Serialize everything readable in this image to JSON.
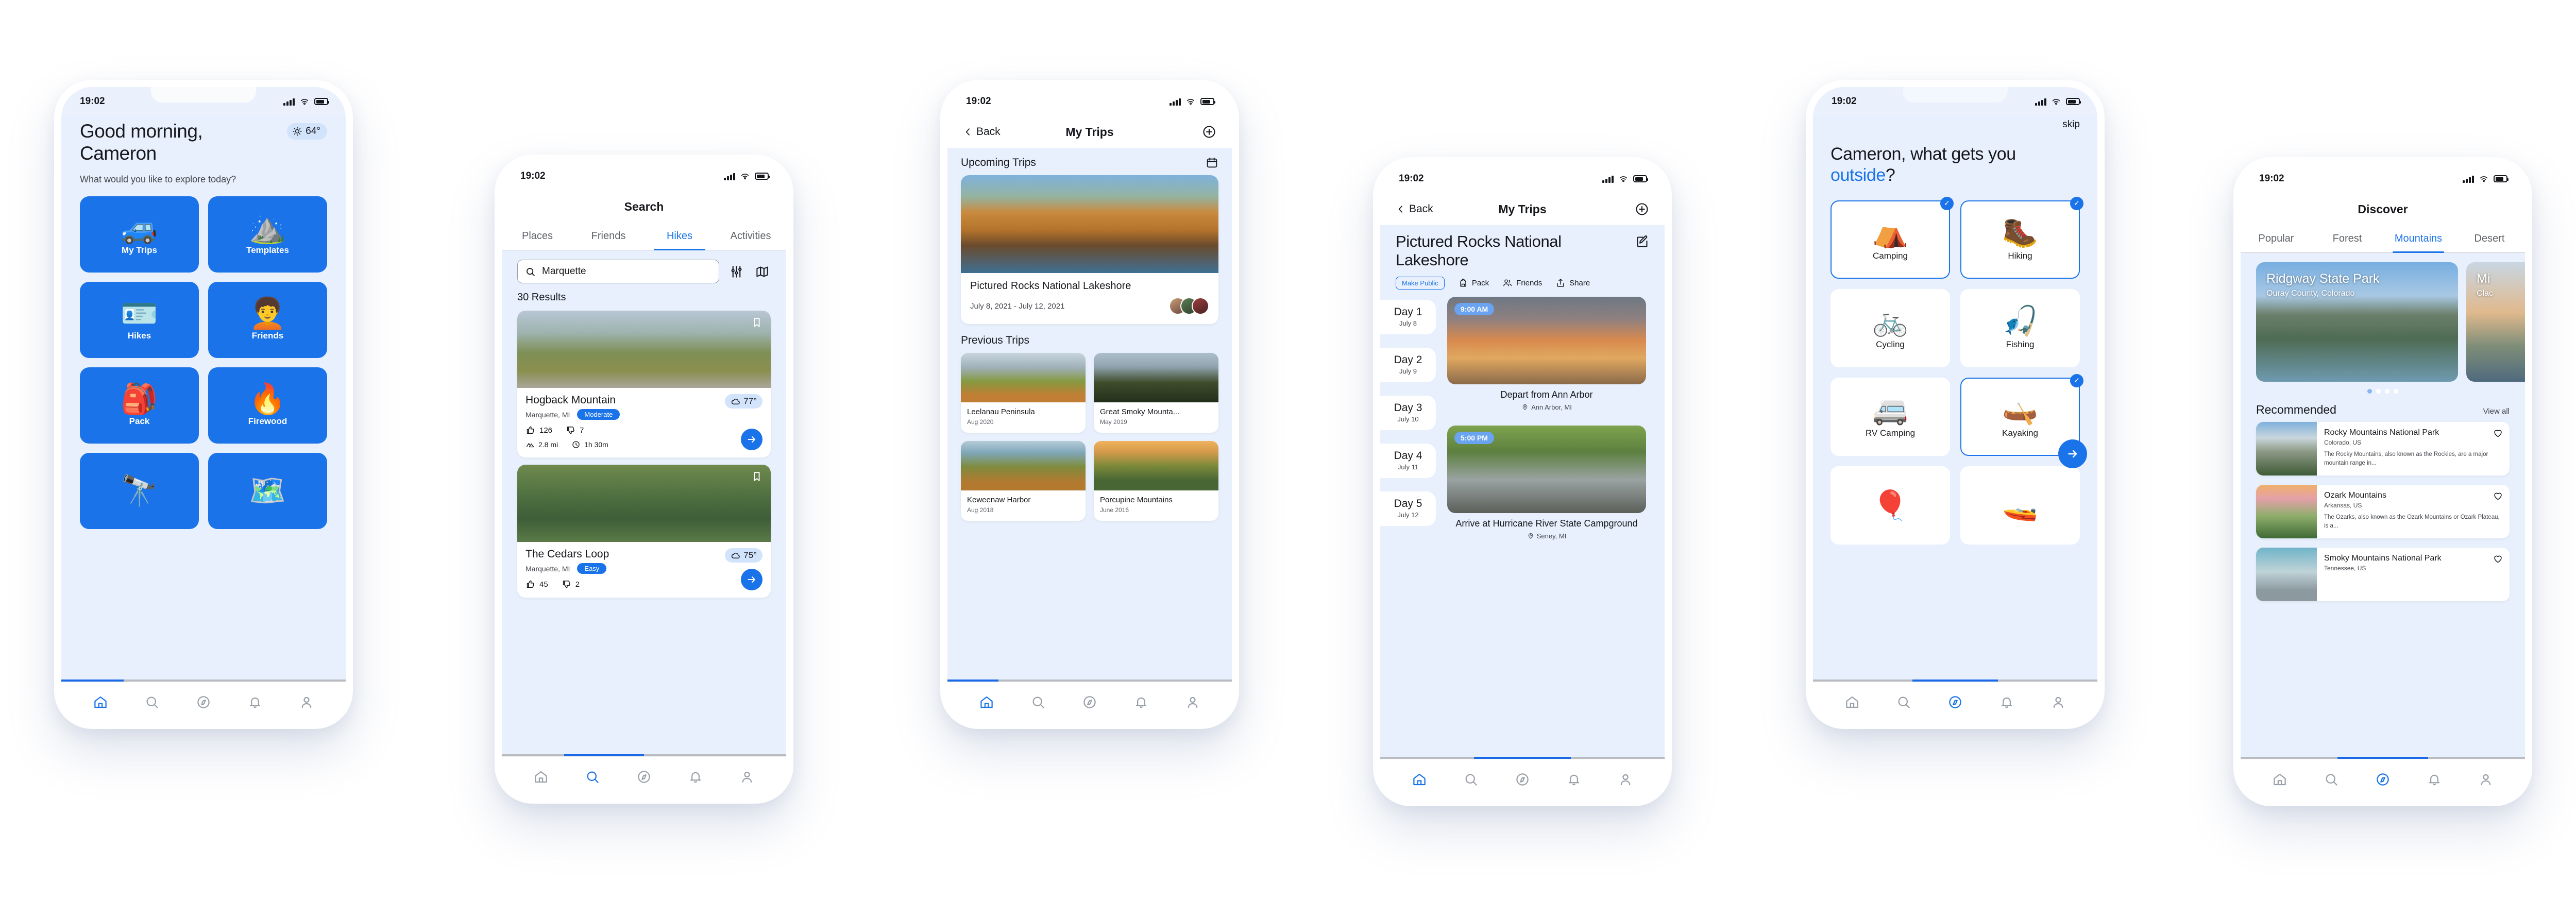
{
  "common": {
    "status_time": "19:02",
    "tabbar": [
      {
        "name": "home-icon",
        "label": "Home"
      },
      {
        "name": "search-icon",
        "label": "Search"
      },
      {
        "name": "compass-icon",
        "label": "Discover"
      },
      {
        "name": "bell-icon",
        "label": "Notifications"
      },
      {
        "name": "person-icon",
        "label": "Profile"
      }
    ],
    "accent": "#1a73e8",
    "screen_bg": "#e8f0fd"
  },
  "phone1": {
    "greeting": "Good morning,\nCameron",
    "weather": {
      "icon": "sun-icon",
      "temp": "64",
      "degree": "°"
    },
    "subtitle": "What would you like to explore today?",
    "tiles": [
      {
        "label": "My Trips",
        "emoji": "🚙",
        "icon": "suv-icon"
      },
      {
        "label": "Templates",
        "emoji": "⛰️",
        "icon": "mountains-icon"
      },
      {
        "label": "Hikes",
        "emoji": "🪪",
        "icon": "signpost-icon"
      },
      {
        "label": "Friends",
        "emoji": "🧑‍🦱",
        "icon": "hiker-icon"
      },
      {
        "label": "Pack",
        "emoji": "🎒",
        "icon": "backpack-icon"
      },
      {
        "label": "Firewood",
        "emoji": "🔥",
        "icon": "campfire-icon"
      },
      {
        "label": "",
        "emoji": "🔭",
        "icon": "binoculars-icon"
      },
      {
        "label": "",
        "emoji": "🗺️",
        "icon": "map-icon"
      }
    ],
    "active_tab": 0
  },
  "phone2": {
    "nav_title": "Search",
    "tabs": [
      "Places",
      "Friends",
      "Hikes",
      "Activities"
    ],
    "active_tab_index": 2,
    "search_value": "Marquette",
    "search_placeholder": "Search",
    "filter_icon": "sliders-icon",
    "map_icon": "map-icon",
    "results_count": "30 Results",
    "cards": [
      {
        "title": "Hogback Mountain",
        "location": "Marquette, MI",
        "difficulty": "Moderate",
        "likes": "126",
        "dislikes": "7",
        "distance": "2.8 mi",
        "duration": "1h 30m",
        "weather_temp": "77",
        "degree": "°"
      },
      {
        "title": "The Cedars Loop",
        "location": "Marquette, MI",
        "difficulty": "Easy",
        "likes": "45",
        "dislikes": "2",
        "distance": "",
        "duration": "",
        "weather_temp": "75",
        "degree": "°"
      }
    ],
    "active_tab": 1
  },
  "phone3": {
    "back_label": "Back",
    "nav_title": "My Trips",
    "add_icon": "plus-circle-icon",
    "upcoming_heading": "Upcoming Trips",
    "calendar_icon": "calendar-icon",
    "upcoming": {
      "title": "Pictured Rocks National Lakeshore",
      "dates": "July 8, 2021 - July 12, 2021"
    },
    "previous_heading": "Previous Trips",
    "previous": [
      {
        "title": "Leelanau Peninsula",
        "date": "Aug 2020"
      },
      {
        "title": "Great Smoky Mounta...",
        "date": "May 2019"
      },
      {
        "title": "Keweenaw Harbor",
        "date": "Aug 2018"
      },
      {
        "title": "Porcupine Mountains",
        "date": "June 2016"
      }
    ],
    "active_tab": 0
  },
  "phone4": {
    "back_label": "Back",
    "nav_title": "My Trips",
    "add_icon": "plus-circle-icon",
    "trip_title": "Pictured Rocks National Lakeshore",
    "edit_icon": "edit-icon",
    "actions": [
      {
        "label": "Make Public",
        "icon": "",
        "style": "outline"
      },
      {
        "label": "Pack",
        "icon": "backpack-icon"
      },
      {
        "label": "Friends",
        "icon": "people-icon"
      },
      {
        "label": "Share",
        "icon": "share-icon"
      }
    ],
    "days": [
      {
        "num": "Day 1",
        "date": "July 8"
      },
      {
        "num": "Day 2",
        "date": "July 9"
      },
      {
        "num": "Day 3",
        "date": "July 10"
      },
      {
        "num": "Day 4",
        "date": "July 11"
      },
      {
        "num": "Day 5",
        "date": "July 12"
      }
    ],
    "events": [
      {
        "time": "9:00 AM",
        "title": "Depart from Ann Arbor",
        "location": "Ann Arbor, MI"
      },
      {
        "time": "5:00 PM",
        "title": "Arrive at Hurricane River State Campground",
        "location": "Seney, MI"
      }
    ],
    "active_tab": 0
  },
  "phone5": {
    "skip_label": "skip",
    "question_pre": "Cameron, what gets you ",
    "question_highlight": "outside",
    "question_post": "?",
    "options": [
      {
        "label": "Camping",
        "emoji": "⛺",
        "icon": "tent-icon",
        "selected": true
      },
      {
        "label": "Hiking",
        "emoji": "🥾",
        "icon": "boot-icon",
        "selected": true
      },
      {
        "label": "Cycling",
        "emoji": "🚲",
        "icon": "bicycle-icon",
        "selected": false
      },
      {
        "label": "Fishing",
        "emoji": "🎣",
        "icon": "fishing-icon",
        "selected": false
      },
      {
        "label": "RV Camping",
        "emoji": "🚐",
        "icon": "rv-icon",
        "selected": false
      },
      {
        "label": "Kayaking",
        "emoji": "🛶",
        "icon": "kayak-icon",
        "selected": true
      },
      {
        "label": "",
        "emoji": "🎈",
        "icon": "balloon-icon",
        "selected": false
      },
      {
        "label": "",
        "emoji": "🚤",
        "icon": "boat-icon",
        "selected": false
      }
    ],
    "next_icon": "arrow-right-icon",
    "active_tab": 2
  },
  "phone6": {
    "nav_title": "Discover",
    "tabs": [
      "Popular",
      "Forest",
      "Mountains",
      "Desert"
    ],
    "active_tab_index": 2,
    "carousel": [
      {
        "title": "Ridgway State Park",
        "subtitle": "Ouray County, Colorado"
      },
      {
        "title": "Mi",
        "subtitle": "Clac"
      }
    ],
    "dots": 4,
    "dot_active": 0,
    "rec_heading": "Recommended",
    "view_all": "View all",
    "recommended": [
      {
        "title": "Rocky Mountains National Park",
        "location": "Colorado, US",
        "description": "The Rocky Mountains, also known as the Rockies, are a major mountain range in..."
      },
      {
        "title": "Ozark Mountains",
        "location": "Arkansas, US",
        "description": "The Ozarks, also known as the Ozark Mountains or Ozark Plateau, is a..."
      },
      {
        "title": "Smoky Mountains National Park",
        "location": "Tennessee, US",
        "description": ""
      }
    ],
    "heart_icon": "heart-icon",
    "active_tab": 2
  }
}
